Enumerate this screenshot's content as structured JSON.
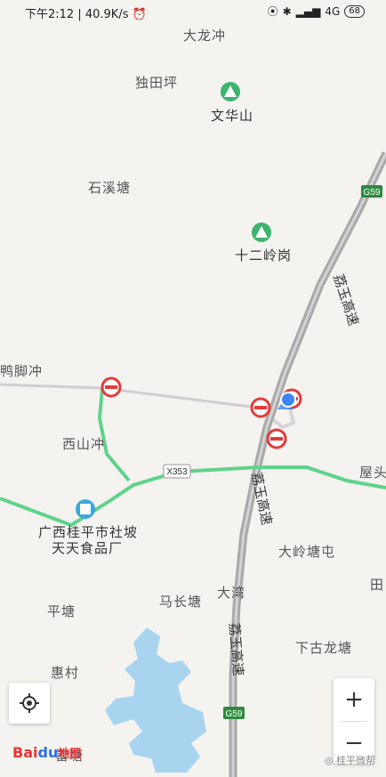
{
  "status_bar": {
    "time": "下午2:12",
    "speed": "40.9K/s",
    "network": "4G",
    "battery": "68"
  },
  "places": {
    "dalongchong": "大龙冲",
    "dutianping": "独田坪",
    "wenhuashan": "文华山",
    "shixitang": "石溪塘",
    "shierlinggang": "十二岭岗",
    "yajiaochong": "鸭脚冲",
    "xishanchong": "西山冲",
    "factory_line1": "广西桂平市社坡",
    "factory_line2": "天天食品厂",
    "wutou": "屋头",
    "dalingtangtun": "大岭塘屯",
    "machangtang": "马长塘",
    "dawan": "大湾",
    "pingtang": "平塘",
    "xiagulongtang": "下古龙塘",
    "huicun": "惠村",
    "tian": "田",
    "leitang": "雷塘"
  },
  "roads": {
    "expressway_name": "荔玉高速",
    "expressway_code": "G59",
    "county_road_code": "X353"
  },
  "controls": {
    "zoom_in": "+",
    "zoom_out": "−"
  },
  "logo": {
    "part1": "Bai",
    "part2": "du",
    "part3": "地图"
  },
  "watermark": "桂平微帮",
  "colors": {
    "expressway": "#b3b3b3",
    "county_road": "#5fd38a",
    "water": "#a8d4f0",
    "poi_green": "#3cb46e",
    "restriction_red": "#e23b3b",
    "location_blue": "#3b86f3"
  }
}
